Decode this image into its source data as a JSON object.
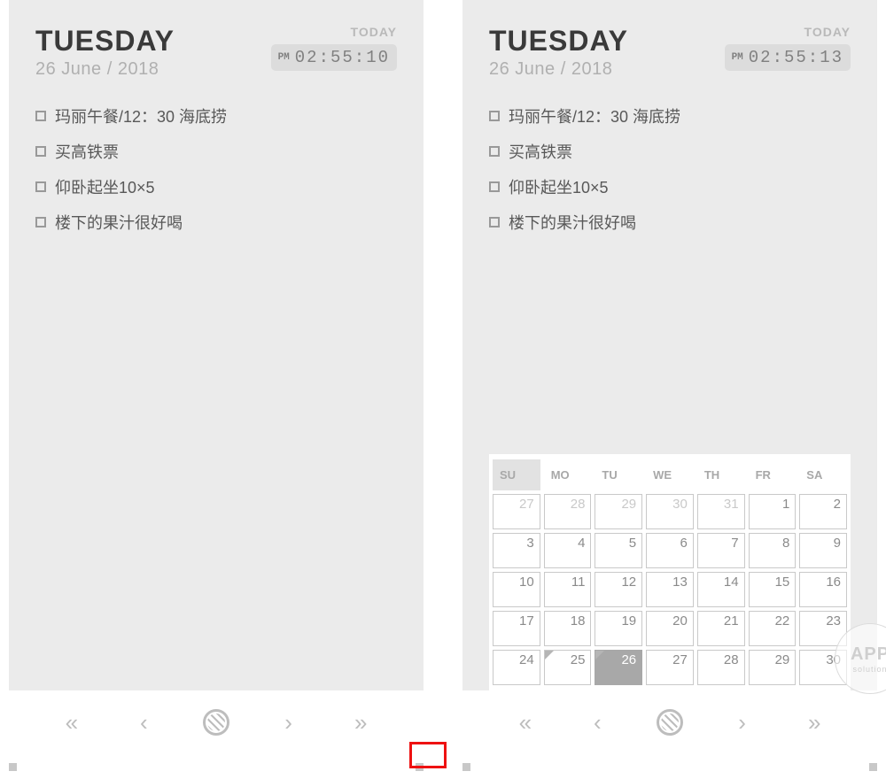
{
  "panes": [
    {
      "day_name": "TUESDAY",
      "date_line": "26 June / 2018",
      "today_label": "TODAY",
      "clock": {
        "ampm": "PM",
        "time": "02:55:10"
      },
      "tasks": [
        "玛丽午餐/12：30 海底捞",
        "买高铁票",
        "仰卧起坐10×5",
        "楼下的果汁很好喝"
      ],
      "show_calendar": false
    },
    {
      "day_name": "TUESDAY",
      "date_line": "26 June / 2018",
      "today_label": "TODAY",
      "clock": {
        "ampm": "PM",
        "time": "02:55:13"
      },
      "tasks": [
        "玛丽午餐/12：30 海底捞",
        "买高铁票",
        "仰卧起坐10×5",
        "楼下的果汁很好喝"
      ],
      "show_calendar": true
    }
  ],
  "calendar": {
    "weekdays": [
      "SU",
      "MO",
      "TU",
      "WE",
      "TH",
      "FR",
      "SA"
    ],
    "cells": [
      {
        "n": "27",
        "dim": true
      },
      {
        "n": "28",
        "dim": true
      },
      {
        "n": "29",
        "dim": true
      },
      {
        "n": "30",
        "dim": true
      },
      {
        "n": "31",
        "dim": true
      },
      {
        "n": "1"
      },
      {
        "n": "2"
      },
      {
        "n": "3"
      },
      {
        "n": "4"
      },
      {
        "n": "5"
      },
      {
        "n": "6"
      },
      {
        "n": "7"
      },
      {
        "n": "8"
      },
      {
        "n": "9"
      },
      {
        "n": "10"
      },
      {
        "n": "11"
      },
      {
        "n": "12"
      },
      {
        "n": "13"
      },
      {
        "n": "14"
      },
      {
        "n": "15"
      },
      {
        "n": "16"
      },
      {
        "n": "17"
      },
      {
        "n": "18"
      },
      {
        "n": "19"
      },
      {
        "n": "20"
      },
      {
        "n": "21"
      },
      {
        "n": "22"
      },
      {
        "n": "23"
      },
      {
        "n": "24"
      },
      {
        "n": "25",
        "mark": true
      },
      {
        "n": "26",
        "today": true,
        "mark": true
      },
      {
        "n": "27"
      },
      {
        "n": "28"
      },
      {
        "n": "29"
      },
      {
        "n": "30"
      }
    ]
  },
  "watermark": {
    "line1": "APP",
    "line2": "solution"
  }
}
